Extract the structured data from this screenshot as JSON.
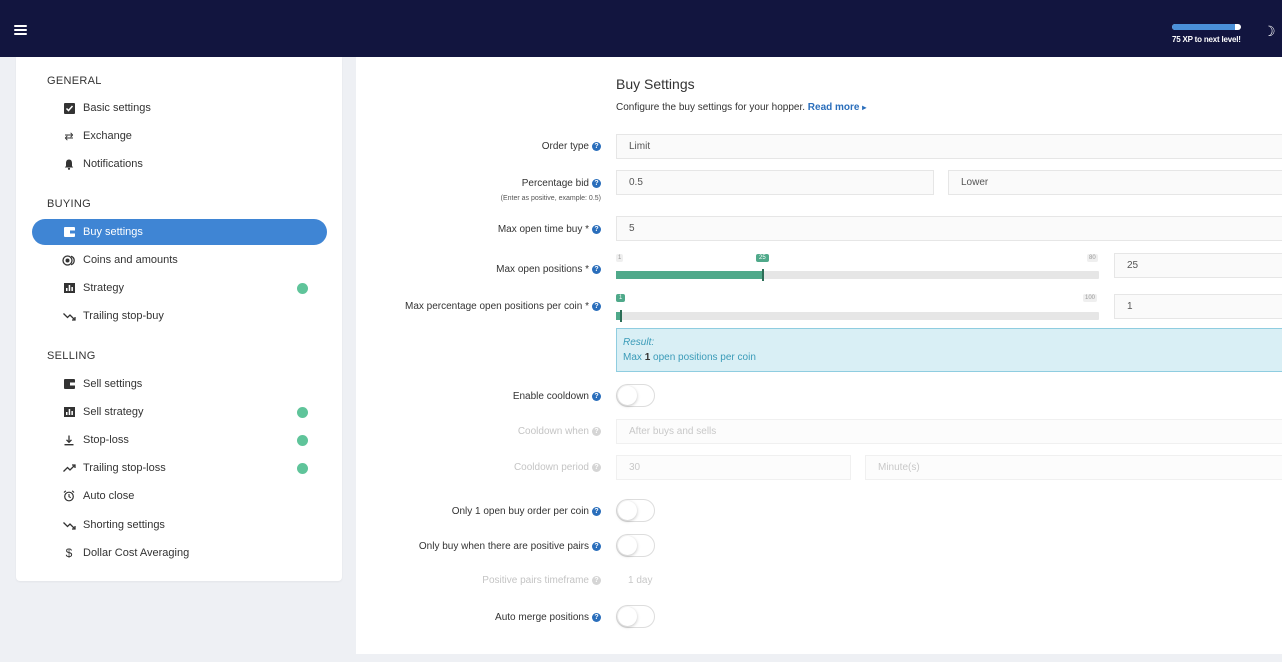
{
  "header": {
    "xp_text": "75 XP to next level!",
    "xp_progress": 0.92,
    "menu_icon": "hamburger-icon",
    "theme_icon": "moon-icon"
  },
  "sidebar": {
    "general_title": "GENERAL",
    "buying_title": "BUYING",
    "selling_title": "SELLING",
    "general": [
      {
        "label": "Basic settings",
        "icon": "checkbox-icon"
      },
      {
        "label": "Exchange",
        "icon": "arrows-swap-icon"
      },
      {
        "label": "Notifications",
        "icon": "bell-icon"
      }
    ],
    "buying": [
      {
        "label": "Buy settings",
        "icon": "wallet-icon",
        "active": true
      },
      {
        "label": "Coins and amounts",
        "icon": "coins-icon"
      },
      {
        "label": "Strategy",
        "icon": "bar-chart-icon",
        "status": true
      },
      {
        "label": "Trailing stop-buy",
        "icon": "trend-down-icon"
      }
    ],
    "selling": [
      {
        "label": "Sell settings",
        "icon": "wallet-icon"
      },
      {
        "label": "Sell strategy",
        "icon": "bar-chart-icon",
        "status": true
      },
      {
        "label": "Stop-loss",
        "icon": "arrow-down-bar-icon",
        "status": true
      },
      {
        "label": "Trailing stop-loss",
        "icon": "trend-up-icon",
        "status": true
      },
      {
        "label": "Auto close",
        "icon": "alarm-clock-icon"
      },
      {
        "label": "Shorting settings",
        "icon": "trend-down-icon"
      },
      {
        "label": "Dollar Cost Averaging",
        "icon": "dollar-icon"
      }
    ],
    "status_color": "#5fc49a",
    "active_color": "#3f85d4"
  },
  "main": {
    "title": "Buy Settings",
    "description": "Configure the buy settings for your hopper.",
    "read_more": "Read more",
    "order_type": {
      "label": "Order type",
      "value": "Limit"
    },
    "percentage_bid": {
      "label": "Percentage bid",
      "sub": "(Enter as positive, example: 0.5)",
      "value": "0.5",
      "direction": "Lower"
    },
    "max_open_time_buy": {
      "label": "Max open time buy *",
      "value": "5"
    },
    "max_open_positions": {
      "label": "Max open positions *",
      "min": "1",
      "max": "80",
      "current": "25",
      "value": "25",
      "fraction": 0.304
    },
    "max_pct_open_positions": {
      "label": "Max percentage open positions per coin *",
      "min": "1",
      "max": "100",
      "current": "1",
      "value": "1",
      "fraction": 0.01
    },
    "result": {
      "title": "Result:",
      "prefix": "Max",
      "value": "1",
      "suffix": "open positions per coin"
    },
    "enable_cooldown": {
      "label": "Enable cooldown",
      "on": false
    },
    "cooldown_when": {
      "label": "Cooldown when",
      "value": "After buys and sells"
    },
    "cooldown_period": {
      "label": "Cooldown period",
      "value": "30",
      "unit": "Minute(s)"
    },
    "one_open_buy": {
      "label": "Only 1 open buy order per coin",
      "on": false
    },
    "positive_pairs": {
      "label": "Only buy when there are positive pairs",
      "on": false
    },
    "positive_pairs_timeframe": {
      "label": "Positive pairs timeframe",
      "value": "1 day"
    },
    "auto_merge": {
      "label": "Auto merge positions",
      "on": false
    }
  }
}
